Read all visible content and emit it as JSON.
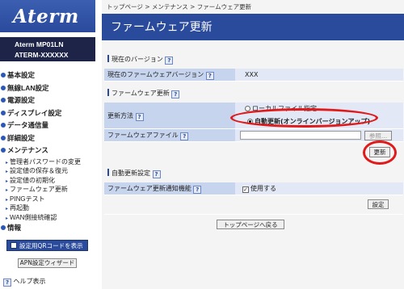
{
  "brand": {
    "logo": "Aterm",
    "model_line1": "Aterm  MP01LN",
    "model_line2": "ATERM-XXXXXX"
  },
  "sidebar": {
    "menu": [
      {
        "label": "基本設定"
      },
      {
        "label": "無線LAN設定"
      },
      {
        "label": "電源設定"
      },
      {
        "label": "ディスプレイ設定"
      },
      {
        "label": "データ通信量"
      },
      {
        "label": "詳細設定"
      },
      {
        "label": "メンテナンス"
      }
    ],
    "maintenance_items": [
      {
        "label": "管理者パスワードの変更"
      },
      {
        "label": "設定値の保存＆復元"
      },
      {
        "label": "設定値の初期化"
      },
      {
        "label": "ファームウェア更新"
      },
      {
        "label": "PINGテスト"
      },
      {
        "label": "再起動"
      },
      {
        "label": "WAN側接続確認"
      }
    ],
    "info_label": "情報",
    "qr_button": "設定用QRコードを表示",
    "apn_button": "APN設定ウィザード",
    "help_label": "ヘルプ表示"
  },
  "breadcrumb": "トップページ > メンテナンス > ファームウェア更新",
  "page_title": "ファームウェア更新",
  "current_version": {
    "title": "現在のバージョン",
    "row_label": "現在のファームウェアバージョン",
    "value": "XXX"
  },
  "firmware_update": {
    "title": "ファームウェア更新",
    "method_label": "更新方法",
    "option_local": "ローカルファイル指定",
    "option_auto": "自動更新(オンラインバージョンアップ)",
    "selected": "option_auto",
    "file_label": "ファームウェアファイル",
    "browse_button": "参照...",
    "update_button": "更新"
  },
  "auto_update": {
    "title": "自動更新設定",
    "row_label": "ファームウェア更新通知機能",
    "checkbox_label": "使用する",
    "checked": true,
    "set_button": "設定"
  },
  "back_button": "トップページへ戻る",
  "help_icon_text": "?",
  "colors": {
    "accent": "#2a4a9c",
    "label_cell": "#c7d4ee",
    "value_cell": "#e2e8f5",
    "highlight": "#e01a1a"
  }
}
